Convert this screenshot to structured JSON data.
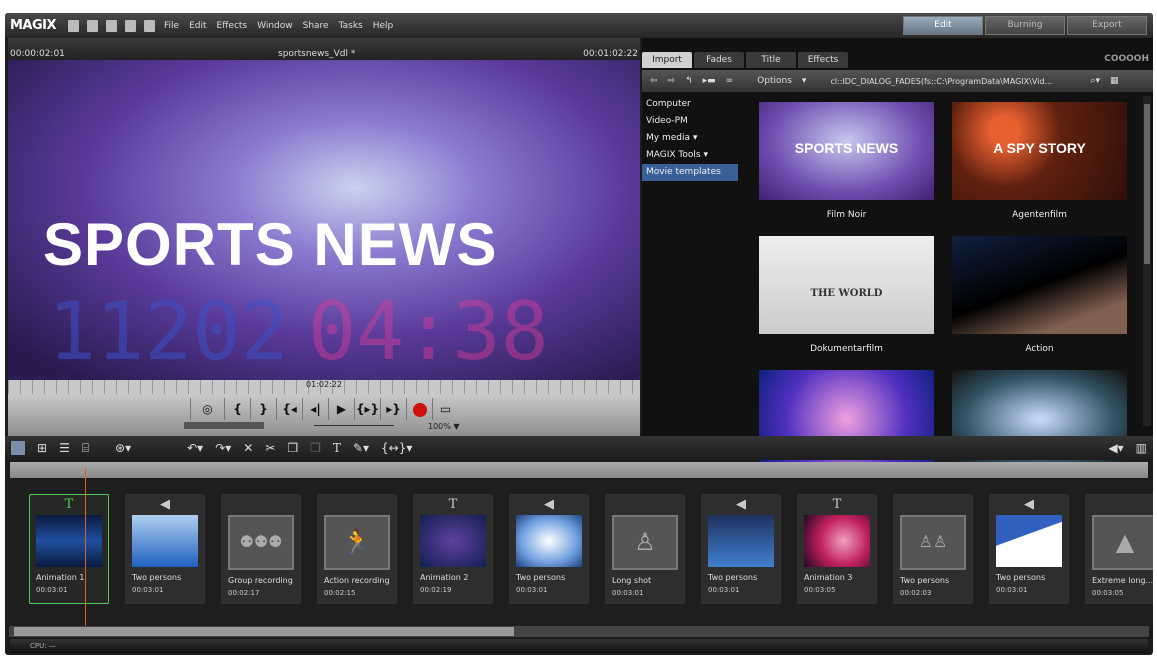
{
  "app": {
    "logo": "MAGIX",
    "menu": [
      "File",
      "Edit",
      "Effects",
      "Window",
      "Share",
      "Tasks",
      "Help"
    ],
    "modes": [
      {
        "label": "Edit",
        "active": true
      },
      {
        "label": "Burning",
        "active": false
      },
      {
        "label": "Export",
        "active": false
      }
    ]
  },
  "preview": {
    "time_current": "00:00:02:01",
    "project": "sportsnews_Vdl *",
    "time_total": "00:01:02:22",
    "title_overlay": "SPORTS NEWS",
    "digits_left": "11202",
    "digits_right": "04:38",
    "ruler_time": "01:02:22",
    "zoom": "100% ▼",
    "transport": [
      "{",
      "}",
      "{◂",
      "◂|",
      "▶",
      "{▸}",
      "▸}"
    ]
  },
  "library": {
    "tabs": [
      "Import",
      "Fades",
      "Title",
      "Effects"
    ],
    "active_tab": "Import",
    "brand": "COOOOH",
    "options_label": "Options",
    "path": "cl::IDC_DIALOG_FADES(fs::C:\\ProgramData\\MAGIX\\Vid...",
    "sidebar": [
      {
        "label": "Computer"
      },
      {
        "label": "Video-PM"
      },
      {
        "label": "My media ▾"
      },
      {
        "label": "MAGIX Tools ▾"
      },
      {
        "label": "Movie templates",
        "selected": true
      }
    ],
    "templates": [
      {
        "name": "Film Noir",
        "overlay": "SPORTS NEWS"
      },
      {
        "name": "Agentenfilm",
        "overlay": "A SPY STORY"
      },
      {
        "name": "Dokumentarfilm",
        "overlay": "THE WORLD"
      },
      {
        "name": "Action",
        "overlay": ""
      },
      {
        "name": "",
        "overlay": ""
      },
      {
        "name": "",
        "overlay": ""
      }
    ]
  },
  "storyboard": {
    "clips": [
      {
        "name": "Animation 1",
        "time": "00:03:01",
        "type": "title",
        "selected": true
      },
      {
        "name": "Two persons",
        "time": "00:03:01",
        "type": "video"
      },
      {
        "name": "Group recording",
        "time": "00:02:17",
        "type": "placeholder",
        "icon": "group-icon"
      },
      {
        "name": "Action recording",
        "time": "00:02:15",
        "type": "placeholder",
        "icon": "running-person-icon"
      },
      {
        "name": "Animation 2",
        "time": "00:02:19",
        "type": "title"
      },
      {
        "name": "Two persons",
        "time": "00:03:01",
        "type": "video"
      },
      {
        "name": "Long shot",
        "time": "00:03:01",
        "type": "placeholder",
        "icon": "person-icon"
      },
      {
        "name": "Two persons",
        "time": "00:03:01",
        "type": "video"
      },
      {
        "name": "Animation 3",
        "time": "00:03:05",
        "type": "title"
      },
      {
        "name": "Two persons",
        "time": "00:02:03",
        "type": "placeholder",
        "icon": "two-persons-icon"
      },
      {
        "name": "Two persons",
        "time": "00:03:01",
        "type": "video"
      },
      {
        "name": "Extreme long...",
        "time": "00:03:05",
        "type": "placeholder",
        "icon": "tree-icon"
      }
    ]
  },
  "status": {
    "cpu": "CPU: —"
  },
  "colors": {
    "accent": "#3a5f98",
    "playhead": "#e06020",
    "selection": "#55cc55",
    "record": "#d01010"
  }
}
